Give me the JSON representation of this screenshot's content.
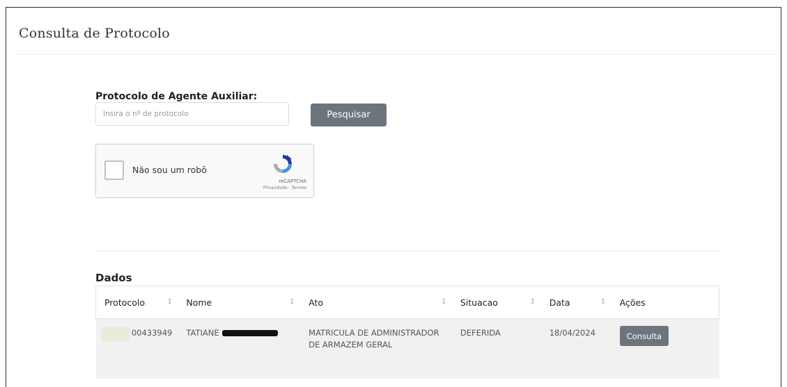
{
  "page": {
    "title": "Consulta de Protocolo"
  },
  "search": {
    "label": "Protocolo de Agente Auxiliar:",
    "placeholder": "Insira o nº de protocolo",
    "value": "",
    "button_label": "Pesquisar"
  },
  "recaptcha": {
    "label": "Não sou um robô",
    "brand": "reCAPTCHA",
    "links": "Privacidade - Termos",
    "checked": false
  },
  "results": {
    "title": "Dados",
    "columns": [
      "Protocolo",
      "Nome",
      "Ato",
      "Situacao",
      "Data",
      "Ações"
    ],
    "rows": [
      {
        "protocolo": "00433949",
        "nome": "TATIANE",
        "ato": "MATRICULA DE ADMINISTRADOR DE ARMAZEM GERAL",
        "situacao": "DEFERIDA",
        "data": "18/04/2024",
        "action_label": "Consulta"
      }
    ]
  },
  "colors": {
    "button_bg": "#6c757d",
    "row_bg": "#f1f1f1",
    "recaptcha_blue": "#1c3aa9"
  },
  "icons": [
    "sort-icon",
    "recaptcha-logo-icon",
    "redaction-bar"
  ]
}
